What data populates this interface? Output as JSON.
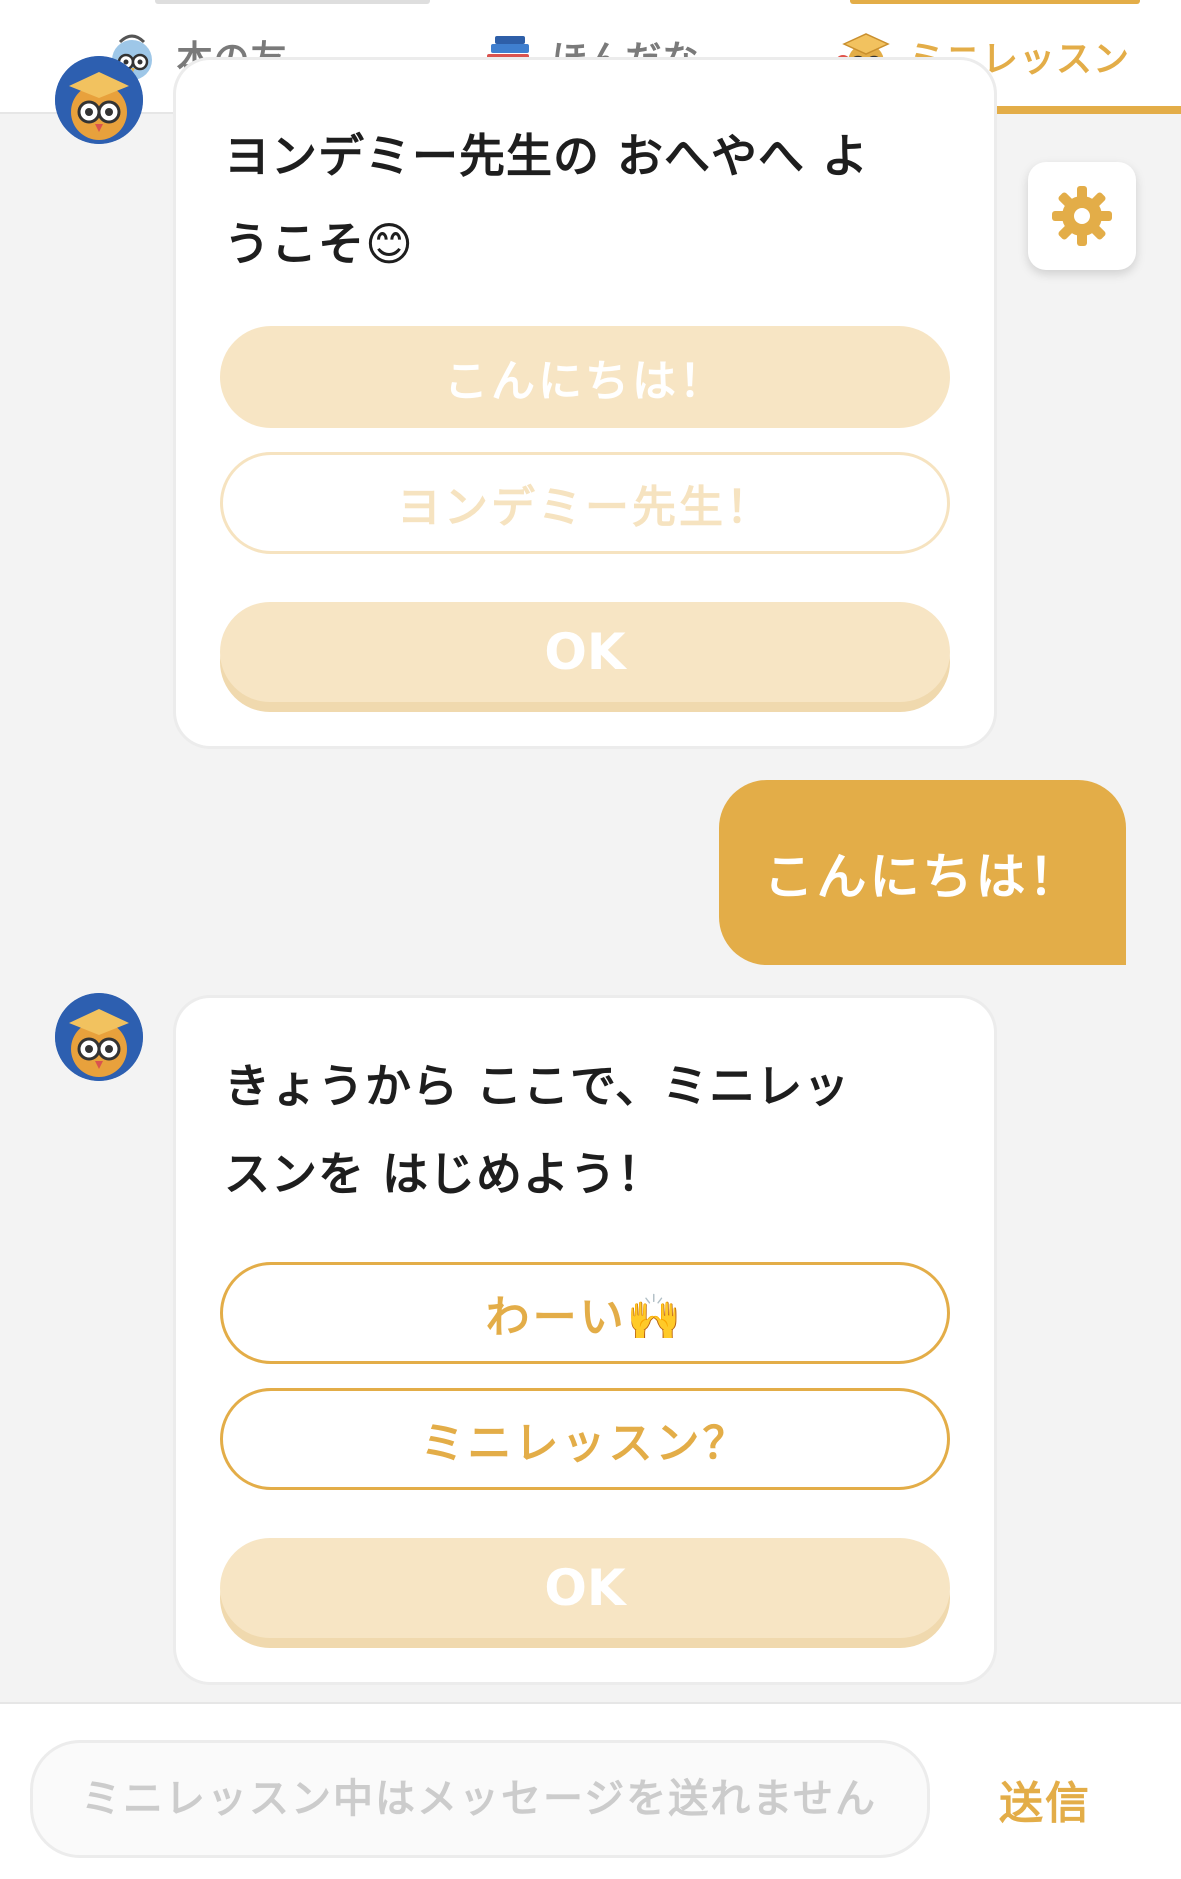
{
  "tabs": [
    {
      "label": "本の友",
      "icon": "owl-bag-icon",
      "active": false
    },
    {
      "label": "ほんだな",
      "icon": "book-stack-icon",
      "active": false
    },
    {
      "label": "ミニレッスン",
      "icon": "owl-graduate-icon",
      "active": true
    }
  ],
  "colors": {
    "accent": "#e3ad48",
    "accent_faded": "#f7e5c4",
    "notification_dot": "#e0544c"
  },
  "settings_icon": "gear-icon",
  "messages": {
    "bot1": {
      "text": "ヨンデミー先生の おへやへ ようこそ😊",
      "line1": "ヨンデミー先生の おへやへ よ",
      "line2": "うこそ😊",
      "options": [
        "こんにちは！",
        "ヨンデミー先生！"
      ],
      "ok_label": "OK"
    },
    "user1": {
      "text": "こんにちは！"
    },
    "bot2": {
      "line1_plain": "きょうから ここで、",
      "line1_bold": "ミニレッ",
      "line2_bold": "スン",
      "line2_plain": "を はじめよう！",
      "options": [
        "わーい🙌",
        "ミニレッスン？"
      ],
      "ok_label": "OK"
    }
  },
  "input": {
    "placeholder": "ミニレッスン中はメッセージを送れません",
    "value": "",
    "send_label": "送信"
  }
}
